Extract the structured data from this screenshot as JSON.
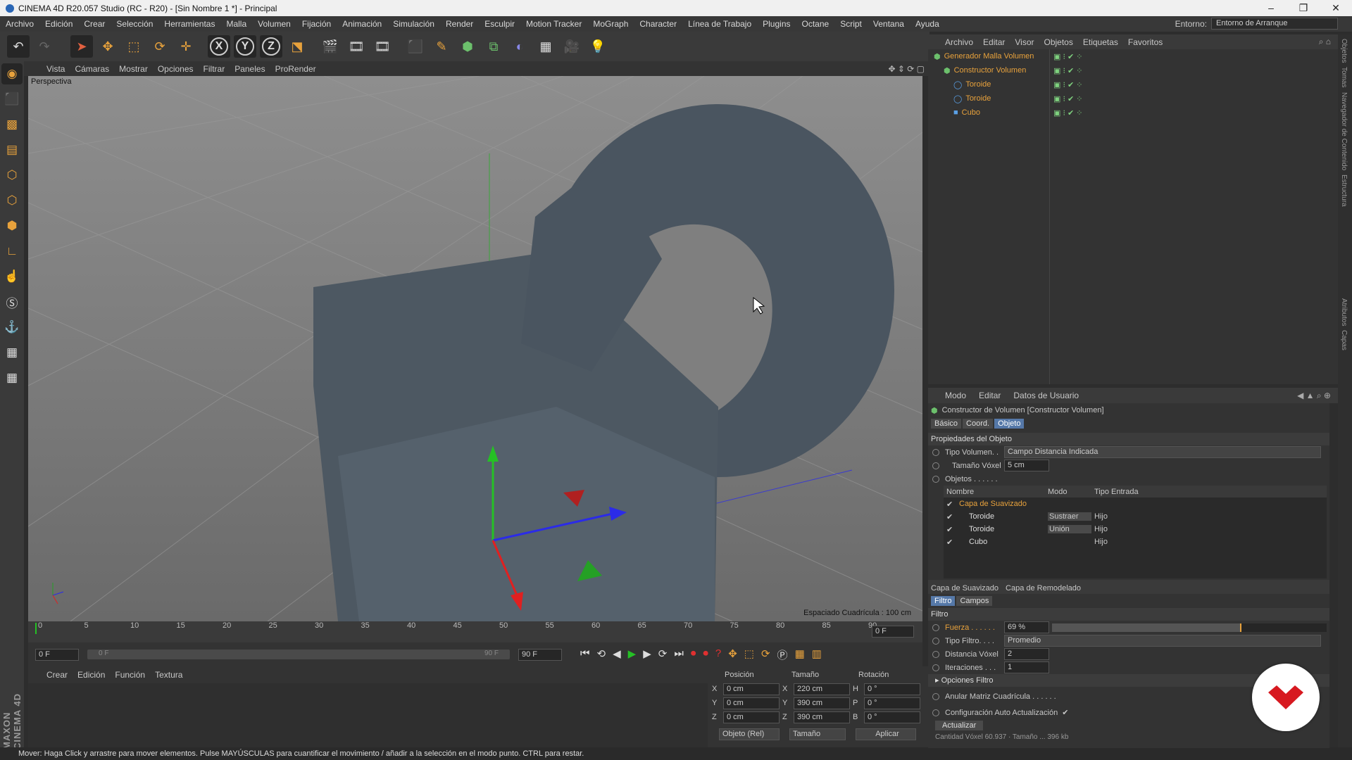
{
  "title_bar": {
    "title": "CINEMA 4D R20.057 Studio (RC - R20) - [Sin Nombre 1 *] - Principal",
    "minimize": "–",
    "maximize": "❐",
    "close": "✕"
  },
  "menu": {
    "items": [
      "Archivo",
      "Edición",
      "Crear",
      "Selección",
      "Herramientas",
      "Malla",
      "Volumen",
      "Fijación",
      "Animación",
      "Simulación",
      "Render",
      "Esculpir",
      "Motion Tracker",
      "MoGraph",
      "Character",
      "Línea de Trabajo",
      "Plugins",
      "Octane",
      "Script",
      "Ventana",
      "Ayuda"
    ],
    "env_label": "Entorno:",
    "env_value": "Entorno de Arranque"
  },
  "viewport": {
    "menu": [
      "Vista",
      "Cámaras",
      "Mostrar",
      "Opciones",
      "Filtrar",
      "Paneles",
      "ProRender"
    ],
    "camera_label": "Perspectiva",
    "grid_spacing": "Espaciado Cuadrícula : 100 cm"
  },
  "timeline": {
    "ticks": [
      "0",
      "5",
      "10",
      "15",
      "20",
      "25",
      "30",
      "35",
      "40",
      "45",
      "50",
      "55",
      "60",
      "65",
      "70",
      "75",
      "80",
      "85",
      "90"
    ],
    "current_frame": "0 F",
    "start_field": "0 F",
    "range_start": "0 F",
    "range_end": "90 F",
    "end_field": "90 F"
  },
  "material_manager": {
    "menu": [
      "Crear",
      "Edición",
      "Función",
      "Textura"
    ]
  },
  "coords": {
    "headers": [
      "Posición",
      "Tamaño",
      "Rotación"
    ],
    "rows": [
      {
        "axis": "X",
        "pos": "0 cm",
        "size_axis": "X",
        "size": "220 cm",
        "rot_axis": "H",
        "rot": "0 °"
      },
      {
        "axis": "Y",
        "pos": "0 cm",
        "size_axis": "Y",
        "size": "390 cm",
        "rot_axis": "P",
        "rot": "0 °"
      },
      {
        "axis": "Z",
        "pos": "0 cm",
        "size_axis": "Z",
        "size": "390 cm",
        "rot_axis": "B",
        "rot": "0 °"
      }
    ],
    "mode": "Objeto (Rel)",
    "size_mode": "Tamaño",
    "apply": "Aplicar"
  },
  "status": "Mover: Haga Click y arrastre para mover elementos. Pulse MAYÚSCULAS para cuantificar el movimiento / añadir a la selección en el modo punto. CTRL para restar.",
  "object_manager": {
    "menu": [
      "Archivo",
      "Editar",
      "Visor",
      "Objetos",
      "Etiquetas",
      "Favoritos"
    ],
    "objects": [
      {
        "name": "Generador Malla Volumen",
        "indent": 0
      },
      {
        "name": "Constructor Volumen",
        "indent": 1
      },
      {
        "name": "Toroide",
        "indent": 2
      },
      {
        "name": "Toroide",
        "indent": 2
      },
      {
        "name": "Cubo",
        "indent": 2
      }
    ]
  },
  "attributes": {
    "menu": [
      "Modo",
      "Editar",
      "Datos de Usuario"
    ],
    "object_title": "Constructor de Volumen [Constructor Volumen]",
    "tabs": [
      "Básico",
      "Coord.",
      "Objeto"
    ],
    "active_tab": "Objeto",
    "section": "Propiedades del Objeto",
    "volume_type_label": "Tipo Volumen. .",
    "volume_type": "Campo Distancia Indicada",
    "voxel_size_label": "Tamaño Vóxel",
    "voxel_size": "5 cm",
    "objects_label": "Objetos . . . . . .",
    "list_headers": [
      "Nombre",
      "Modo",
      "Tipo Entrada"
    ],
    "list": [
      {
        "name": "Capa de Suavizado",
        "mode": "",
        "type": "",
        "highlight": true
      },
      {
        "name": "Toroide",
        "mode": "Sustraer",
        "type": "Hijo",
        "highlight": false
      },
      {
        "name": "Toroide",
        "mode": "Unión",
        "type": "Hijo",
        "highlight": false
      },
      {
        "name": "Cubo",
        "mode": "",
        "type": "Hijo",
        "highlight": false
      }
    ],
    "layer_tabs": [
      "Capa de Suavizado",
      "Capa de Remodelado"
    ],
    "subtabs": [
      "Filtro",
      "Campos"
    ],
    "filter_section": "Filtro",
    "strength_label": "Fuerza . . . . . .",
    "strength": "69 %",
    "strength_value": 69,
    "filter_type_label": "Tipo Filtro. . . .",
    "filter_type": "Promedio",
    "voxel_dist_label": "Distancia Vóxel",
    "voxel_dist": "2",
    "iterations_label": "Iteraciones . . .",
    "iterations": "1",
    "filter_options": "Opciones Filtro",
    "override_grid": "Anular Matriz Cuadrícula . . . . . .",
    "auto_update": "Configuración Auto Actualización",
    "update_button": "Actualizar",
    "footer": "Cantidad Vóxel 60.937 · Tamaño ... 396 kb"
  },
  "right_strip": [
    "Objetos",
    "Tomas",
    "Navegador de Contenido",
    "Estructura",
    "Atributos",
    "Capas"
  ],
  "colors": {
    "accent": "#e8a23c",
    "active_tab": "#5578a8",
    "badge": "#d71920"
  }
}
